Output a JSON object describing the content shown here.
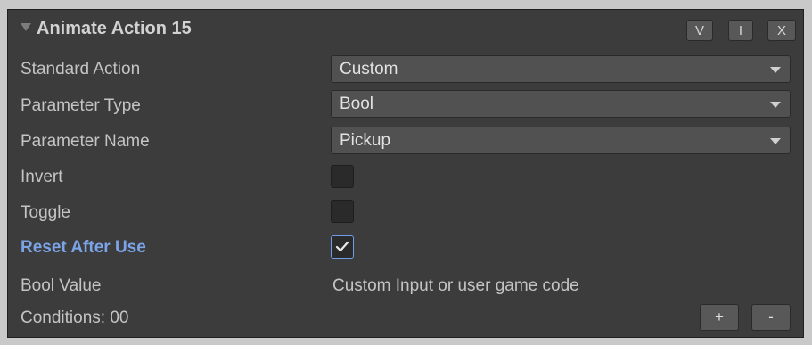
{
  "header": {
    "title": "Animate Action 15",
    "buttons": {
      "v": "V",
      "i": "I",
      "x": "X"
    }
  },
  "fields": {
    "standard_action": {
      "label": "Standard Action",
      "value": "Custom"
    },
    "parameter_type": {
      "label": "Parameter Type",
      "value": "Bool"
    },
    "parameter_name": {
      "label": "Parameter Name",
      "value": "Pickup"
    },
    "invert": {
      "label": "Invert",
      "checked": false
    },
    "toggle": {
      "label": "Toggle",
      "checked": false
    },
    "reset_after_use": {
      "label": "Reset After Use",
      "checked": true
    },
    "bool_value": {
      "label": "Bool Value",
      "value": "Custom Input or user game code"
    }
  },
  "footer": {
    "conditions_label": "Conditions: 00",
    "add_label": "+",
    "remove_label": "-"
  },
  "colors": {
    "panel_bg": "#3c3c3c",
    "accent_label": "#7ba4e8"
  },
  "icons": {
    "foldout": "triangle-down-icon",
    "dropdown": "chevron-down-icon",
    "check": "checkmark-icon"
  }
}
